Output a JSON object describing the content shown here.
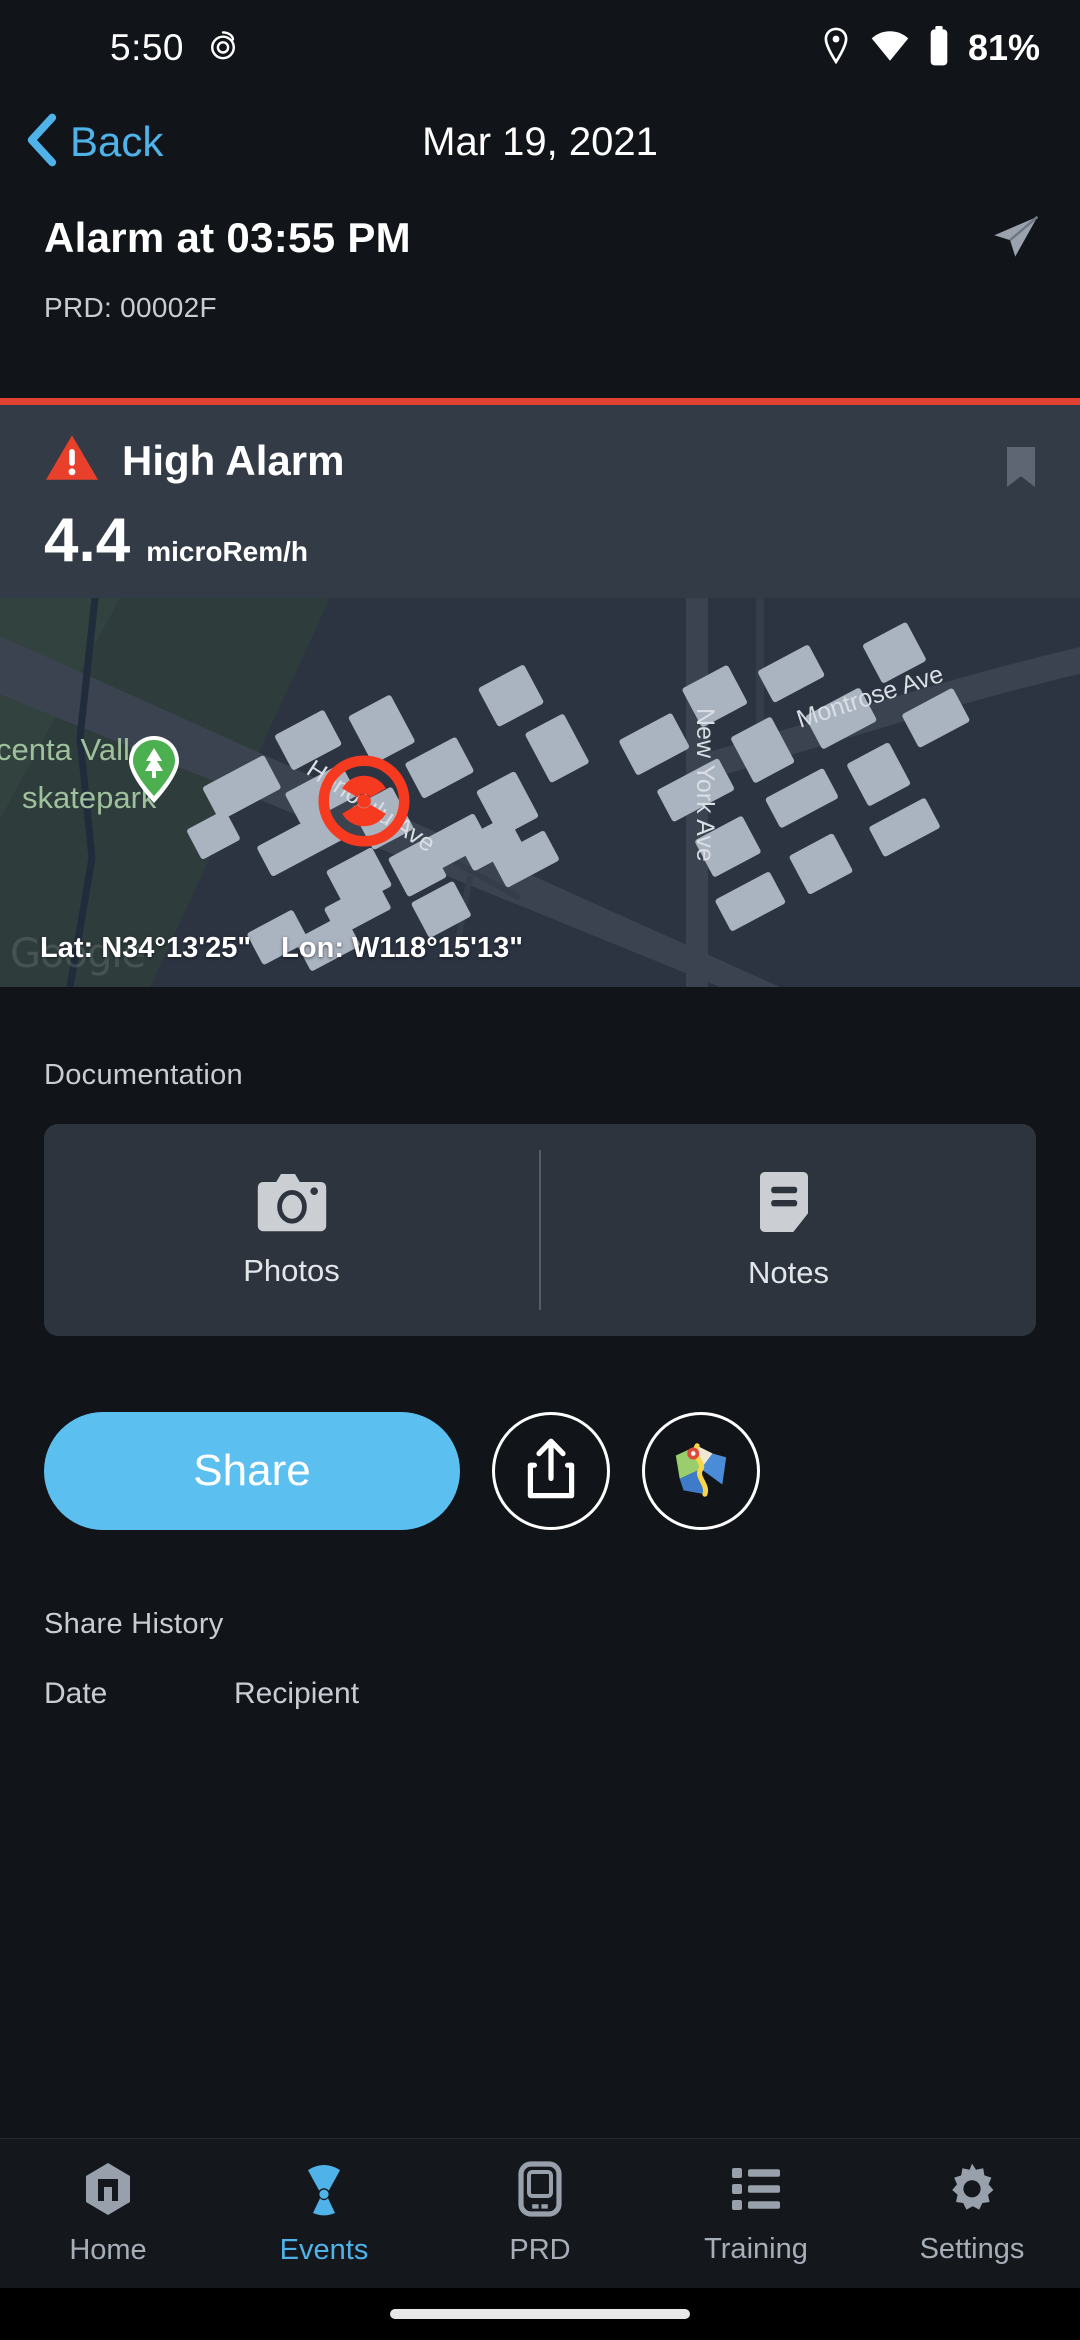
{
  "status_bar": {
    "time": "5:50",
    "alarm_icon": "alarm-clock-icon",
    "location_icon": "location-pin-icon",
    "wifi_icon": "wifi-icon",
    "battery_icon": "battery-icon",
    "battery_level": "81%"
  },
  "nav": {
    "back_label": "Back",
    "back_icon": "chevron-left-icon",
    "title": "Mar 19, 2021"
  },
  "event": {
    "title": "Alarm at 03:55 PM",
    "prd": "PRD: 00002F",
    "send_icon": "send-arrow-icon"
  },
  "alarm": {
    "warning_icon": "warning-triangle-icon",
    "label": "High Alarm",
    "bookmark_icon": "bookmark-icon",
    "reading_value": "4.4",
    "reading_unit": "microRem/h",
    "accent_color": "#E24030",
    "band_color": "#333B46"
  },
  "map": {
    "place_label_line1": "...centa Valley",
    "place_label_line2": "skatepark",
    "park_pin_icon": "park-tree-pin-icon",
    "alarm_marker_icon": "radiation-marker-icon",
    "streets": [
      "Honolulu Ave",
      "New York Ave",
      "Montrose Ave"
    ],
    "lat": "Lat: N34°13'25\"",
    "lon": "Lon: W118°15'13\"",
    "watermark": "Google"
  },
  "documentation": {
    "section_label": "Documentation",
    "photos": {
      "label": "Photos",
      "icon": "camera-icon"
    },
    "notes": {
      "label": "Notes",
      "icon": "note-icon"
    }
  },
  "actions": {
    "share_label": "Share",
    "share_color": "#5BC0F0",
    "export_icon": "export-share-icon",
    "maps_icon": "google-maps-icon"
  },
  "share_history": {
    "section_label": "Share History",
    "columns": [
      "Date",
      "Recipient"
    ],
    "rows": []
  },
  "tab_bar": {
    "active": "Events",
    "items": [
      {
        "label": "Home",
        "icon": "home-shield-icon"
      },
      {
        "label": "Events",
        "icon": "radiation-icon"
      },
      {
        "label": "PRD",
        "icon": "device-icon"
      },
      {
        "label": "Training",
        "icon": "list-icon"
      },
      {
        "label": "Settings",
        "icon": "gear-icon"
      }
    ]
  }
}
